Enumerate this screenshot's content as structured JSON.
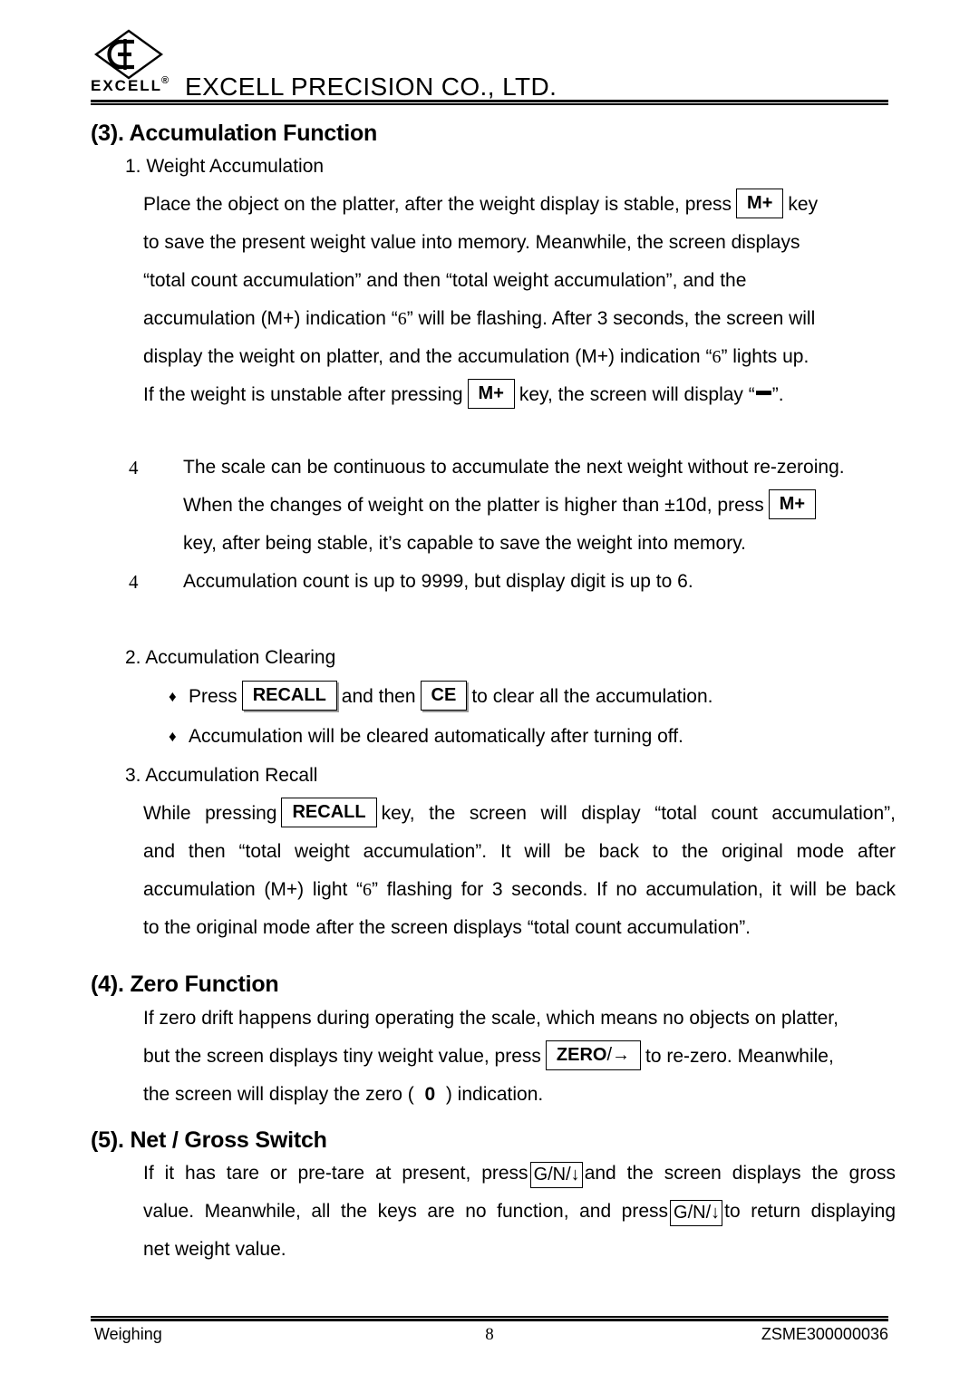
{
  "header": {
    "logo_word": "EXCELL",
    "logo_registered": "®",
    "logo_mark": "EC-diamond",
    "company_name": "EXCELL PRECISION CO., LTD."
  },
  "sections": [
    {
      "heading": "(3). Accumulation Function",
      "sub1": {
        "label": "1. Weight Accumulation",
        "para_lines": [
          "Place the object on the platter, after the weight display is stable, press",
          "key",
          "to save the present weight value into memory. Meanwhile, the screen displays",
          "“total count accumulation” and then “total weight accumulation”, and the",
          "accumulation (M+) indication “",
          "” will be flashing. After 3 seconds, the screen will",
          "display the weight on platter, and the accumulation (M+) indication “",
          "” lights up.",
          "If the weight is unstable after pressing",
          "key, the screen will display “",
          "”."
        ],
        "key_mplus": "M+",
        "indicator_six": "6"
      },
      "bullets": [
        {
          "mark": "4",
          "lines": [
            "The scale can be continuous to accumulate the next weight without re-zeroing.",
            "When the changes of weight on the platter is higher than ±10d, press",
            "key, after being stable, it’s capable to save the weight into memory."
          ],
          "key": "M+"
        },
        {
          "mark": "4",
          "lines": [
            "Accumulation count is up to 9999, but display digit is up to 6."
          ]
        }
      ],
      "sub2": {
        "label": "2. Accumulation Clearing",
        "items": [
          {
            "mark": "♦",
            "pre": "Press",
            "key1": "RECALL",
            "mid": "and then",
            "key2": "CE",
            "post": "to clear all the accumulation."
          },
          {
            "mark": "♦",
            "text": "Accumulation will be cleared automatically after turning off."
          }
        ]
      },
      "sub3": {
        "label": "3. Accumulation Recall",
        "key_recall": "RECALL",
        "indicator_six": "6",
        "lines": [
          "While pressing",
          "key, the screen will display “total count accumulation”,",
          "and then “total weight accumulation”. It will be back to the original mode after",
          "accumulation (M+) light “",
          "” flashing for 3 seconds. If no accumulation, it will be back",
          "to the original mode after the screen displays “total count accumulation”."
        ]
      }
    },
    {
      "heading": "(4). Zero Function",
      "key_zero_main": "ZERO",
      "key_zero_arrow": "/→",
      "zero_indicator": "0",
      "lines": [
        "If zero drift happens during operating the scale, which means no objects on platter,",
        "but the screen displays tiny weight value, press",
        "to re-zero. Meanwhile,",
        "the screen will display the zero (",
        ") indication."
      ]
    },
    {
      "heading": "(5). Net / Gross Switch",
      "key_gn": "G/N/↓",
      "lines": [
        "If it has tare or pre-tare at present, press",
        "and the screen displays the gross",
        "value. Meanwhile, all the keys are no function, and press",
        "to return displaying",
        "net weight value."
      ]
    }
  ],
  "footer": {
    "left": "Weighing",
    "page_number": "8",
    "right": "ZSME300000036"
  }
}
